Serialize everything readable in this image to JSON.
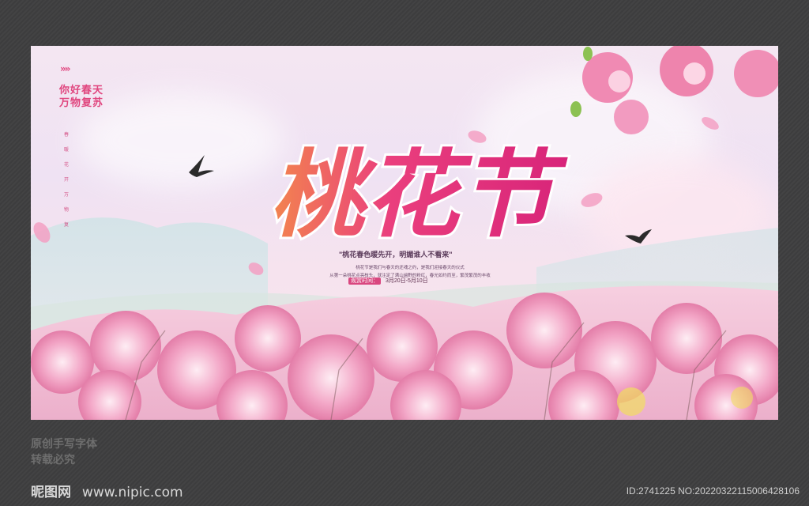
{
  "poster": {
    "chevrons": "»»",
    "brand_line1": "你好春天",
    "brand_line2": "万物复苏",
    "vertical_text": [
      "春",
      "暖",
      "花",
      "开",
      "万",
      "物",
      "复"
    ],
    "title": "桃花节",
    "tagline": "\"桃花春色暖先开，明媚谁人不看来\"",
    "desc_line1": "桃花节是我们与春天的还魂之约，是我们迎接春天的仪式",
    "desc_line2": "从第一朵桃花点亮枝头，就注定了满山遍野的粉红，春光如约而至，繁茂繁茂的丰收",
    "date_label": "观赏时间：",
    "date_value": "3月20日-5月10日"
  },
  "watermark": {
    "line1": "原创手写字体",
    "line2": "转载必究",
    "site_logo": "昵图网",
    "site_url": "www.nipic.com",
    "id_text": "ID:2741225 NO:20220322115006428106"
  },
  "colors": {
    "frame": "#3f3f40",
    "accent": "#e0457e",
    "title_pink": "#e8407f"
  }
}
